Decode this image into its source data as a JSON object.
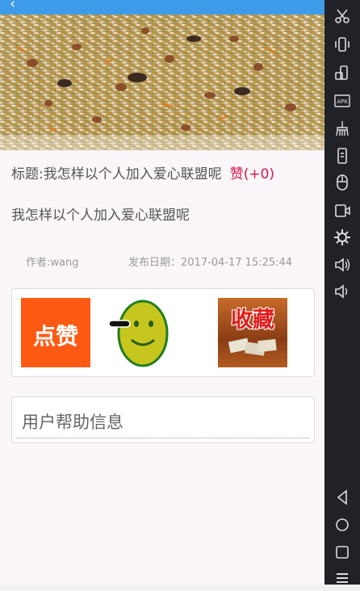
{
  "post": {
    "title": "标题:我怎样以个人加入爱心联盟呢",
    "likes": "赞(+0)",
    "content": "我怎样以个人加入爱心联盟呢",
    "author": "作者:wang",
    "date": "发布日期：2017-04-17 15:25:44"
  },
  "actions": {
    "like_label": "点赞",
    "favorite_label": "收藏"
  },
  "help": {
    "title": "用户帮助信息"
  },
  "colors": {
    "topbar": "#3d9be9",
    "likes": "#d6174c",
    "like_button": "#ff5a14",
    "favorite_text": "#e21b1b",
    "emulator_bar": "#202227"
  },
  "icons": [
    "back-arrow-icon",
    "scissors-icon",
    "vibrate-icon",
    "rotate-icon",
    "apk-icon",
    "broom-icon",
    "screenshot-icon",
    "mouse-icon",
    "camera-icon",
    "settings-icon",
    "volume-up-icon",
    "volume-down-icon",
    "nav-back-icon",
    "nav-home-icon",
    "nav-recents-icon",
    "menu-icon"
  ]
}
